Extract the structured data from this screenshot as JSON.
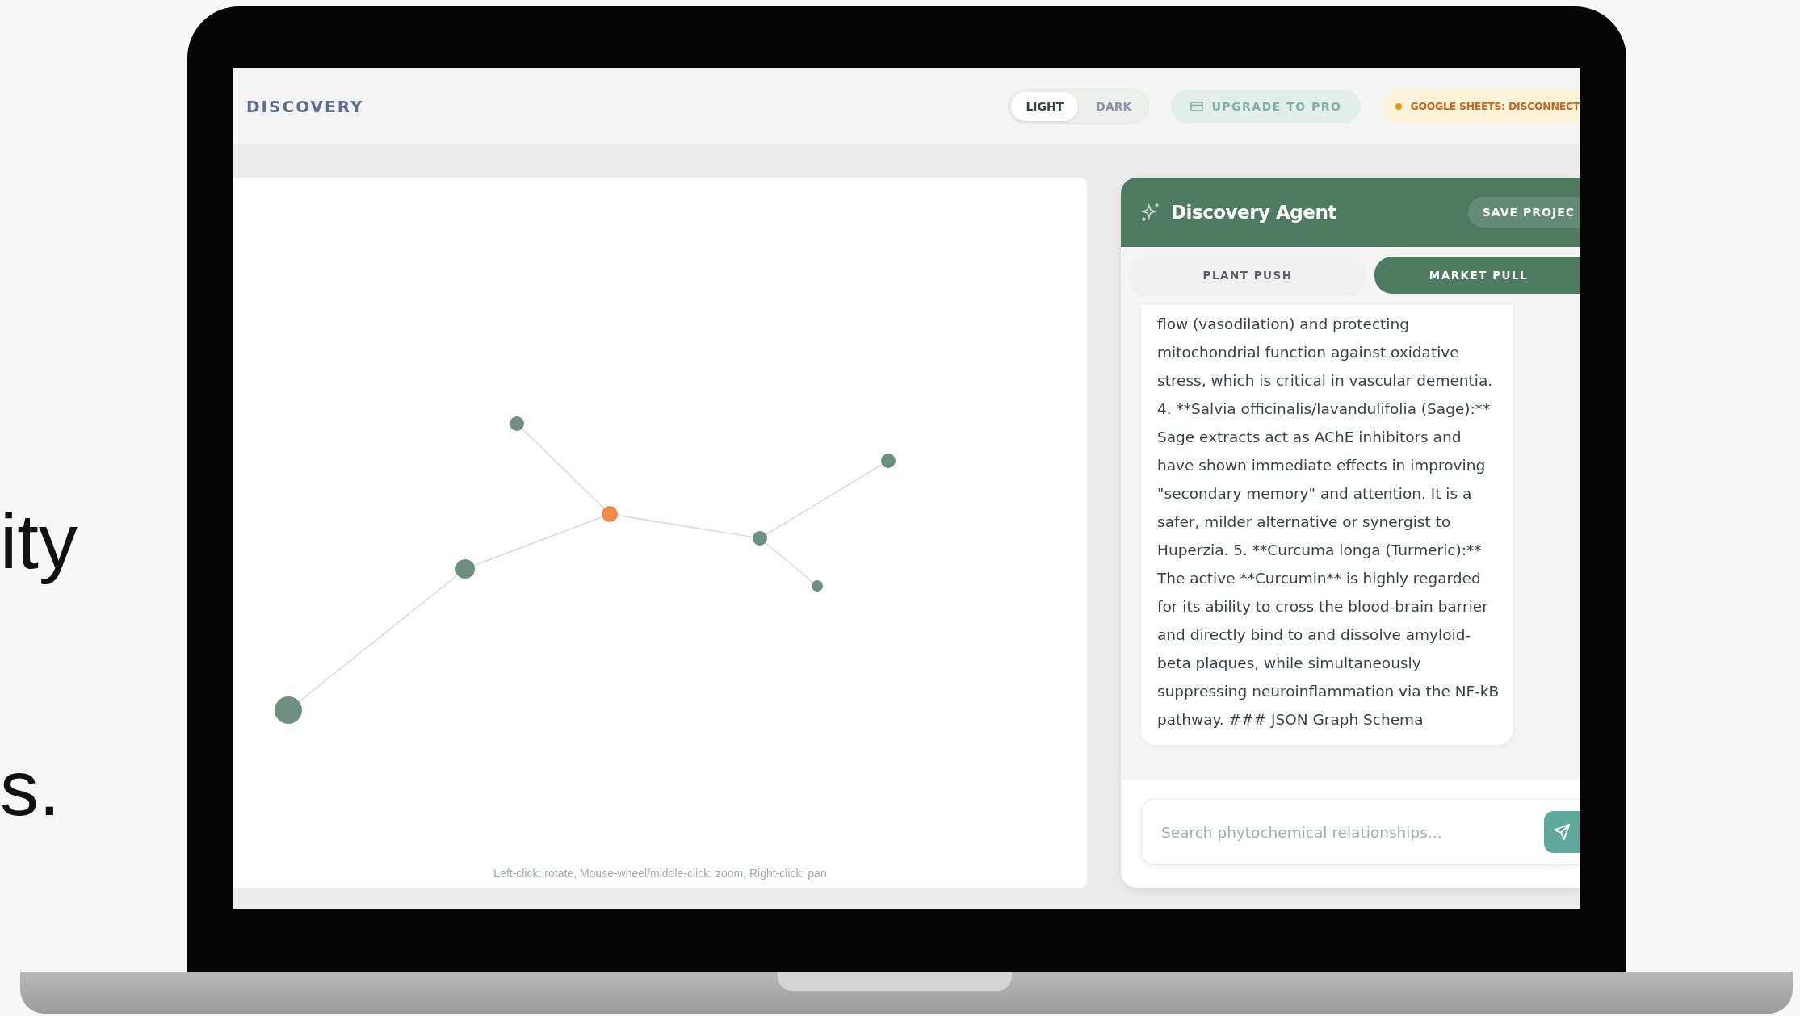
{
  "slide_text": [
    "ity",
    "s."
  ],
  "app": {
    "brand": "DISCOVERY",
    "theme_toggle": [
      {
        "label": "LIGHT",
        "selected": true
      },
      {
        "label": "DARK",
        "selected": false
      }
    ],
    "upgrade_button": "UPGRADE TO PRO",
    "sheets_status": "GOOGLE SHEETS: DISCONNECT",
    "graph": {
      "hint": "Left-click: rotate, Mouse-wheel/middle-click: zoom, Right-click: pan"
    },
    "agent": {
      "title": "Discovery Agent",
      "save_button": "SAVE PROJEC",
      "tabs": [
        {
          "label": "PLANT PUSH",
          "selected": false
        },
        {
          "label": "MARKET PULL",
          "selected": true
        }
      ],
      "message": "flow (vasodilation) and protecting mitochondrial function against oxidative stress, which is critical in vascular dementia. 4. **Salvia officinalis/lavandulifolia (Sage):** Sage extracts act as AChE inhibitors and have shown immediate effects in improving \"secondary memory\" and attention. It is a safer, milder alternative or synergist to Huperzia. 5. **Curcuma longa (Turmeric):** The active **Curcumin** is highly regarded for its ability to cross the blood-brain barrier and directly bind to and dissolve amyloid-beta plaques, while simultaneously suppressing neuroinflammation via the NF-kB pathway. ### JSON Graph Schema",
      "input": {
        "placeholder": "Search phytochemical relationships..."
      }
    }
  }
}
